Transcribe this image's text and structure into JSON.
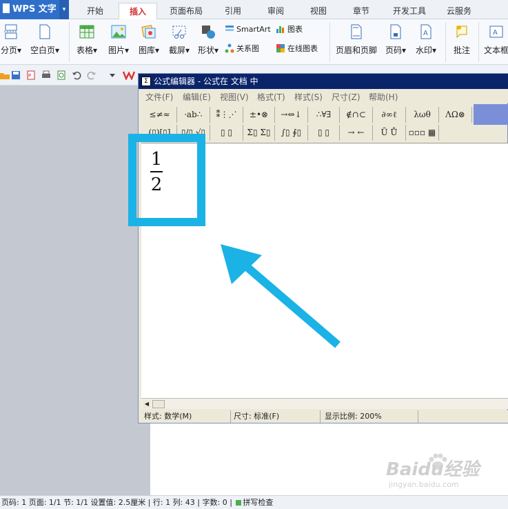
{
  "app": {
    "name": "WPS 文字"
  },
  "tabs": [
    "开始",
    "插入",
    "页面布局",
    "引用",
    "审阅",
    "视图",
    "章节",
    "开发工具",
    "云服务"
  ],
  "active_tab": "插入",
  "ribbon": {
    "page_break": "分页",
    "blank_page": "空白页",
    "table": "表格",
    "picture": "图片",
    "gallery": "图库",
    "screenshot": "截屏",
    "shapes": "形状",
    "smartart": "SmartArt",
    "chart": "图表",
    "relation_chart": "关系图",
    "online_chart": "在线图表",
    "header_footer": "页眉和页脚",
    "page_number": "页码",
    "watermark": "水印",
    "comment": "批注",
    "textbox": "文本框",
    "caret": "▾"
  },
  "equation_editor": {
    "title": "公式编辑器 - 公式在 文档 中",
    "menu": [
      "文件(F)",
      "编辑(E)",
      "视图(V)",
      "格式(T)",
      "样式(S)",
      "尺寸(Z)",
      "帮助(H)"
    ],
    "toolbar_row1": [
      "≤≠≈",
      "⸱ab∴",
      "⁑⋮⋰",
      "±•⊗",
      "→⇔↓",
      "∴∀∃",
      "∉∩⊂",
      "∂∞ℓ",
      "λωθ",
      "ΛΩ⊗"
    ],
    "toolbar_row2": [
      "(▯)[▯]",
      "▯/▯ √▯",
      "▯ ▯",
      "Σ▯ Σ▯",
      "∫▯ ∮▯",
      "▯ ▯",
      "→ ←",
      "Ū Ů",
      "▫▫▫ ▦"
    ],
    "fraction": {
      "numerator": "1",
      "denominator": "2"
    },
    "status": {
      "style": "样式: 数学(M)",
      "size": "尺寸: 标准(F)",
      "zoom": "显示比例: 200%"
    }
  },
  "status_bar": {
    "text": "页码: 1  页面: 1/1  节: 1/1  设置值: 2.5厘米 | 行: 1  列: 43 | 字数: 0 |",
    "spell": "拼写检查"
  },
  "watermark": {
    "brand": "Baidu经验",
    "url": "jingyan.baidu.com"
  },
  "colors": {
    "highlight": "#1bb2e6",
    "title_bar": "#0a246a",
    "app_button": "#2f6fc9",
    "active_tab_text": "#cc3333"
  },
  "toolbar_icons": [
    "open-icon",
    "save-icon",
    "export-pdf-icon",
    "print-icon",
    "print-preview-icon",
    "undo-icon",
    "redo-icon",
    "dropdown-icon",
    "wps-logo-icon"
  ]
}
